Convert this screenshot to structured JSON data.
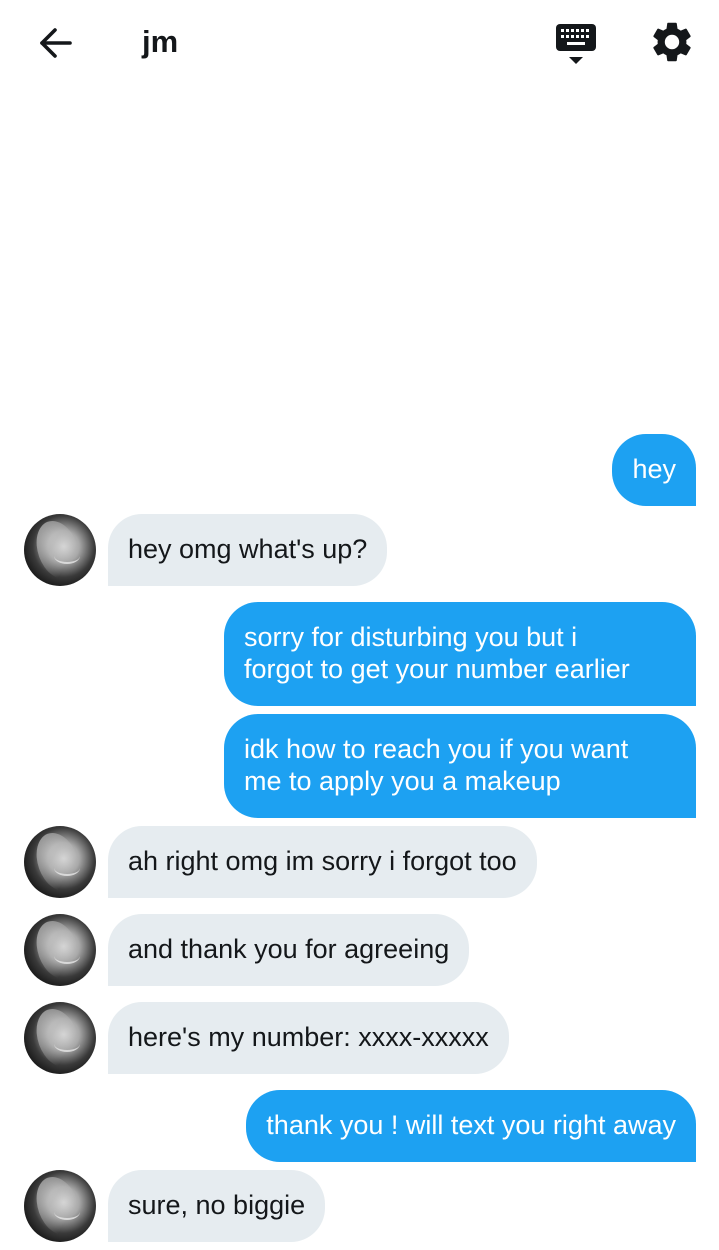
{
  "header": {
    "title": "jm",
    "icons": {
      "back": "arrow-left-icon",
      "keyboard": "keyboard-icon",
      "settings": "gear-icon"
    }
  },
  "colors": {
    "outgoing_bubble": "#1da1f2",
    "incoming_bubble": "#e6ecf0",
    "outgoing_text": "#ffffff",
    "incoming_text": "#14171a"
  },
  "messages": [
    {
      "direction": "out",
      "text": "hey"
    },
    {
      "direction": "in",
      "text": "hey omg what's up?"
    },
    {
      "direction": "out",
      "text": "sorry for disturbing you but i\nforgot to get your number earlier"
    },
    {
      "direction": "out",
      "text": "idk how to reach you if you want\nme to apply you a makeup"
    },
    {
      "direction": "in",
      "text": "ah right omg im sorry i forgot too"
    },
    {
      "direction": "in",
      "text": "and thank you for agreeing"
    },
    {
      "direction": "in",
      "text": "here's my number: xxxx-xxxxx"
    },
    {
      "direction": "out",
      "text": "thank you ! will text you right away"
    },
    {
      "direction": "in",
      "text": "sure, no biggie"
    }
  ]
}
